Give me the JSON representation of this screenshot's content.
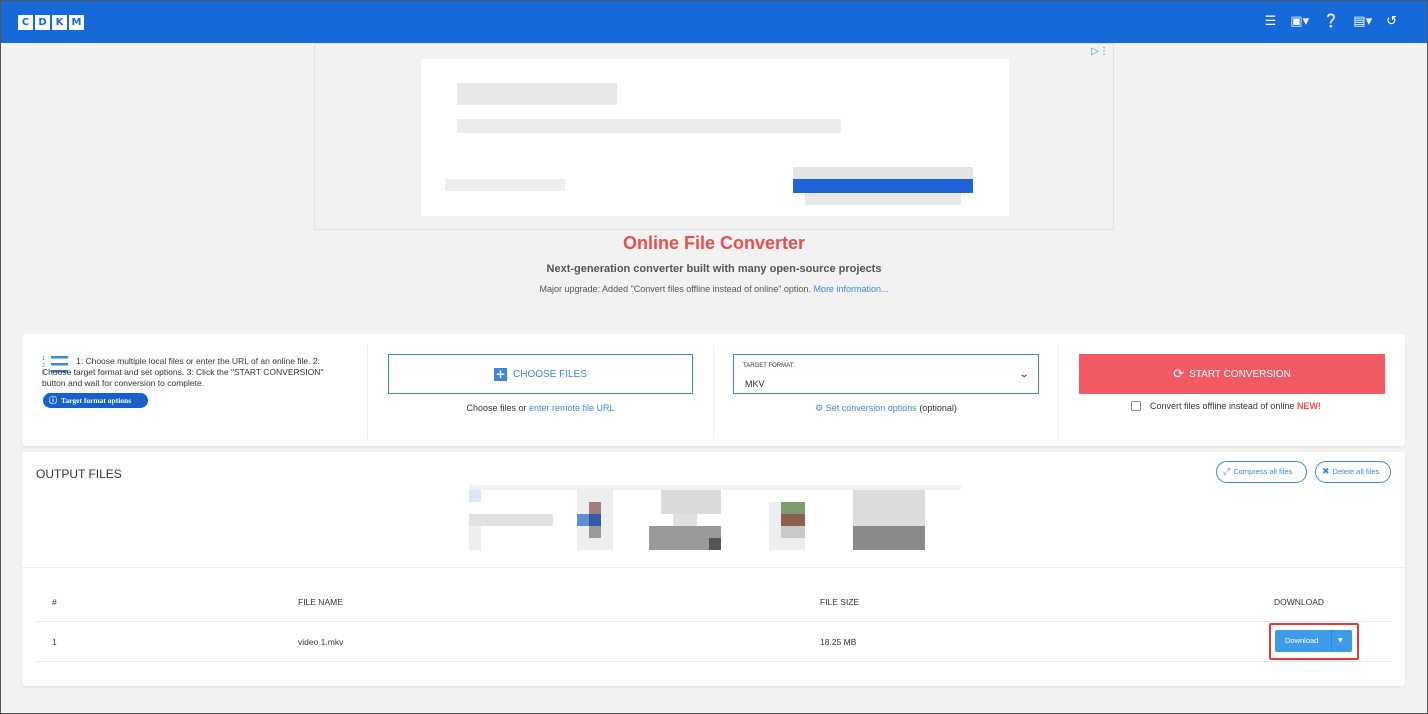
{
  "header": {
    "logo_letters": [
      "C",
      "D",
      "K",
      "M"
    ],
    "icons": [
      "layers-icon",
      "toolbox-icon",
      "help-icon",
      "language-icon",
      "history-icon"
    ]
  },
  "hero": {
    "title": "Online File Converter",
    "subtitle": "Next-generation converter built with many open-source projects",
    "upgrade_text": "Major upgrade: Added \"Convert files offline instead of online\" option.",
    "upgrade_link": "More information..."
  },
  "converter": {
    "steps_text": "1: Choose multiple local files or enter the URL of an online file. 2: Choose target format and set options. 3: Click the \"START CONVERSION\" button and wait for conversion to complete.",
    "target_format_options_label": "Target format options",
    "choose_files_label": "CHOOSE FILES",
    "choose_sub_prefix": "Choose files or",
    "choose_sub_link": "enter remote file URL",
    "target_format_label": "TARGET FORMAT:",
    "target_format_value": "MKV",
    "set_options_link": "Set conversion options",
    "set_options_suffix": "(optional)",
    "start_label": "START CONVERSION",
    "offline_label": "Convert files offline instead of online",
    "offline_new": "NEW!"
  },
  "output": {
    "title": "OUTPUT FILES",
    "compress_all": "Compress all files",
    "delete_all": "Delete all files",
    "columns": [
      "#",
      "FILE NAME",
      "FILE SIZE",
      "DOWNLOAD"
    ],
    "rows": [
      {
        "index": "1",
        "file_name": "video 1.mkv",
        "file_size": "18.25 MB",
        "download_label": "Download"
      }
    ]
  },
  "colors": {
    "header_blue": "#1569d8",
    "accent_blue": "#3d86e6",
    "title_red": "#e8504f",
    "start_red": "#f15a62",
    "highlight_red": "#e53935"
  }
}
